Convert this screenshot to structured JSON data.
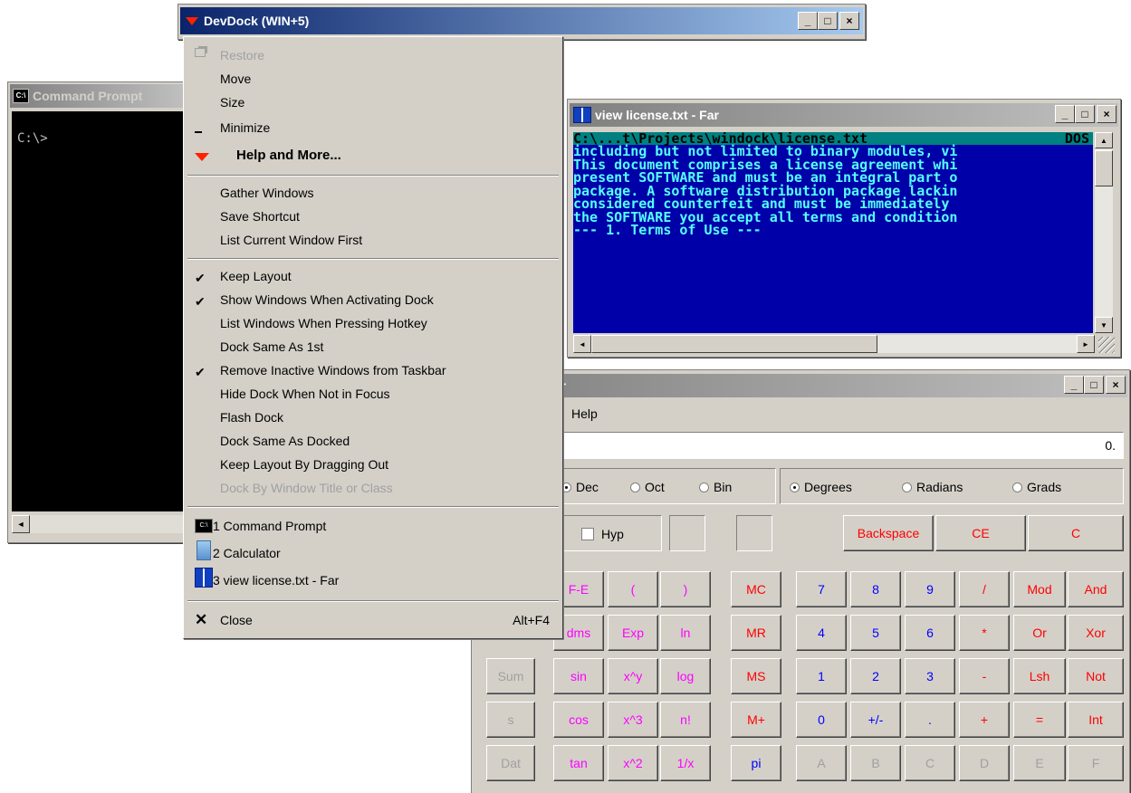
{
  "cmd": {
    "title": "Command Prompt",
    "icon": "cmd-icon",
    "prompt_text": "C:\\>",
    "scroll_left": "◄"
  },
  "far": {
    "title": "view license.txt - Far",
    "header_path": "C:\\...t\\Projects\\windock\\license.txt",
    "header_mode": "DOS",
    "lines": [
      "including but not limited to binary modules, vi",
      "",
      "",
      "This document comprises a license agreement whi",
      "present SOFTWARE and must be an integral part o",
      "package. A software distribution package lackin",
      "considered counterfeit and must be immediately ",
      "the SOFTWARE you accept all terms and condition",
      "",
      "",
      "",
      "--- 1. Terms of Use ---"
    ]
  },
  "devdock": {
    "title": "DevDock (WIN+5)"
  },
  "caption_buttons": {
    "minimize": "_",
    "maximize": "□",
    "close": "×"
  },
  "menu": {
    "restore": "Restore",
    "move": "Move",
    "size": "Size",
    "minimize": "Minimize",
    "help_more": "Help and More...",
    "gather_windows": "Gather Windows",
    "save_shortcut": "Save Shortcut",
    "list_current_first": "List Current Window First",
    "keep_layout": "Keep Layout",
    "show_windows_activating": "Show Windows When Activating Dock",
    "list_windows_hotkey": "List Windows When Pressing Hotkey",
    "dock_same_as_1st": "Dock Same As 1st",
    "remove_inactive": "Remove Inactive Windows from Taskbar",
    "hide_dock": "Hide Dock When Not in Focus",
    "flash_dock": "Flash Dock",
    "dock_same_as_docked": "Dock Same As Docked",
    "keep_layout_dragging": "Keep Layout By Dragging Out",
    "dock_by_title": "Dock By Window Title or Class",
    "win1": "1 Command Prompt",
    "win2": "2 Calculator",
    "win3": "3 view license.txt - Far",
    "close": "Close",
    "close_shortcut": "Alt+F4",
    "checkmark": "✔"
  },
  "calc": {
    "title_fragment": "or",
    "menu_help": "Help",
    "display": "0.",
    "radix": {
      "dec": "Dec",
      "oct": "Oct",
      "bin": "Bin"
    },
    "angle": {
      "degrees": "Degrees",
      "radians": "Radians",
      "grads": "Grads"
    },
    "hyp": "Hyp",
    "backspace": "Backspace",
    "ce": "CE",
    "c": "C",
    "sci_col1": [
      "F-E",
      "dms",
      "sin",
      "cos",
      "tan"
    ],
    "sci_col2": [
      "(",
      "Exp",
      "x^y",
      "x^3",
      "x^2"
    ],
    "sci_col3": [
      ")",
      "ln",
      "log",
      "n!",
      "1/x"
    ],
    "mem": [
      "MC",
      "MR",
      "MS",
      "M+",
      "pi"
    ],
    "stat": [
      "Sum",
      "s",
      "Dat"
    ],
    "digits": [
      "7",
      "8",
      "9",
      "4",
      "5",
      "6",
      "1",
      "2",
      "3",
      "0",
      "+/-",
      "."
    ],
    "ops": [
      "/",
      "*",
      "-",
      "+"
    ],
    "equals": "=",
    "logic": [
      "Mod",
      "And",
      "Or",
      "Xor",
      "Lsh",
      "Not",
      "=",
      "Int"
    ],
    "hex": [
      "A",
      "B",
      "C",
      "D",
      "E",
      "F"
    ]
  }
}
